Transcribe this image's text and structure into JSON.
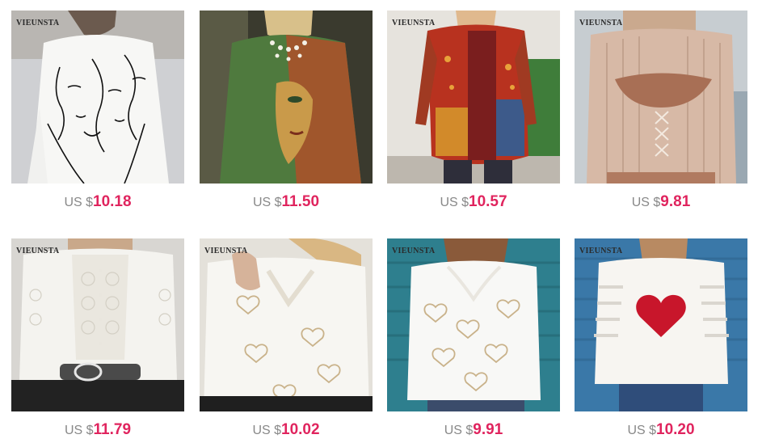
{
  "currency_label": "US $",
  "brand_mark": "VIEUNSTA",
  "colors": {
    "price": "#e0245e",
    "currency": "#888888"
  },
  "products": [
    {
      "price": "10.18",
      "image": "white line-art face print dress",
      "brand_shown": true
    },
    {
      "price": "11.50",
      "image": "green and rust abstract face top",
      "brand_shown": false
    },
    {
      "price": "10.57",
      "image": "red patchwork paisley asymmetric top",
      "brand_shown": true
    },
    {
      "price": "9.81",
      "image": "beige knit cutout lace-up top",
      "brand_shown": true
    },
    {
      "price": "11.79",
      "image": "white lace long sleeve blouse",
      "brand_shown": true
    },
    {
      "price": "10.02",
      "image": "white heart print lace v-neck top",
      "brand_shown": true
    },
    {
      "price": "9.91",
      "image": "white heart print scalloped v-neck top",
      "brand_shown": true
    },
    {
      "price": "10.20",
      "image": "red sequin heart cold shoulder top",
      "brand_shown": true
    }
  ]
}
